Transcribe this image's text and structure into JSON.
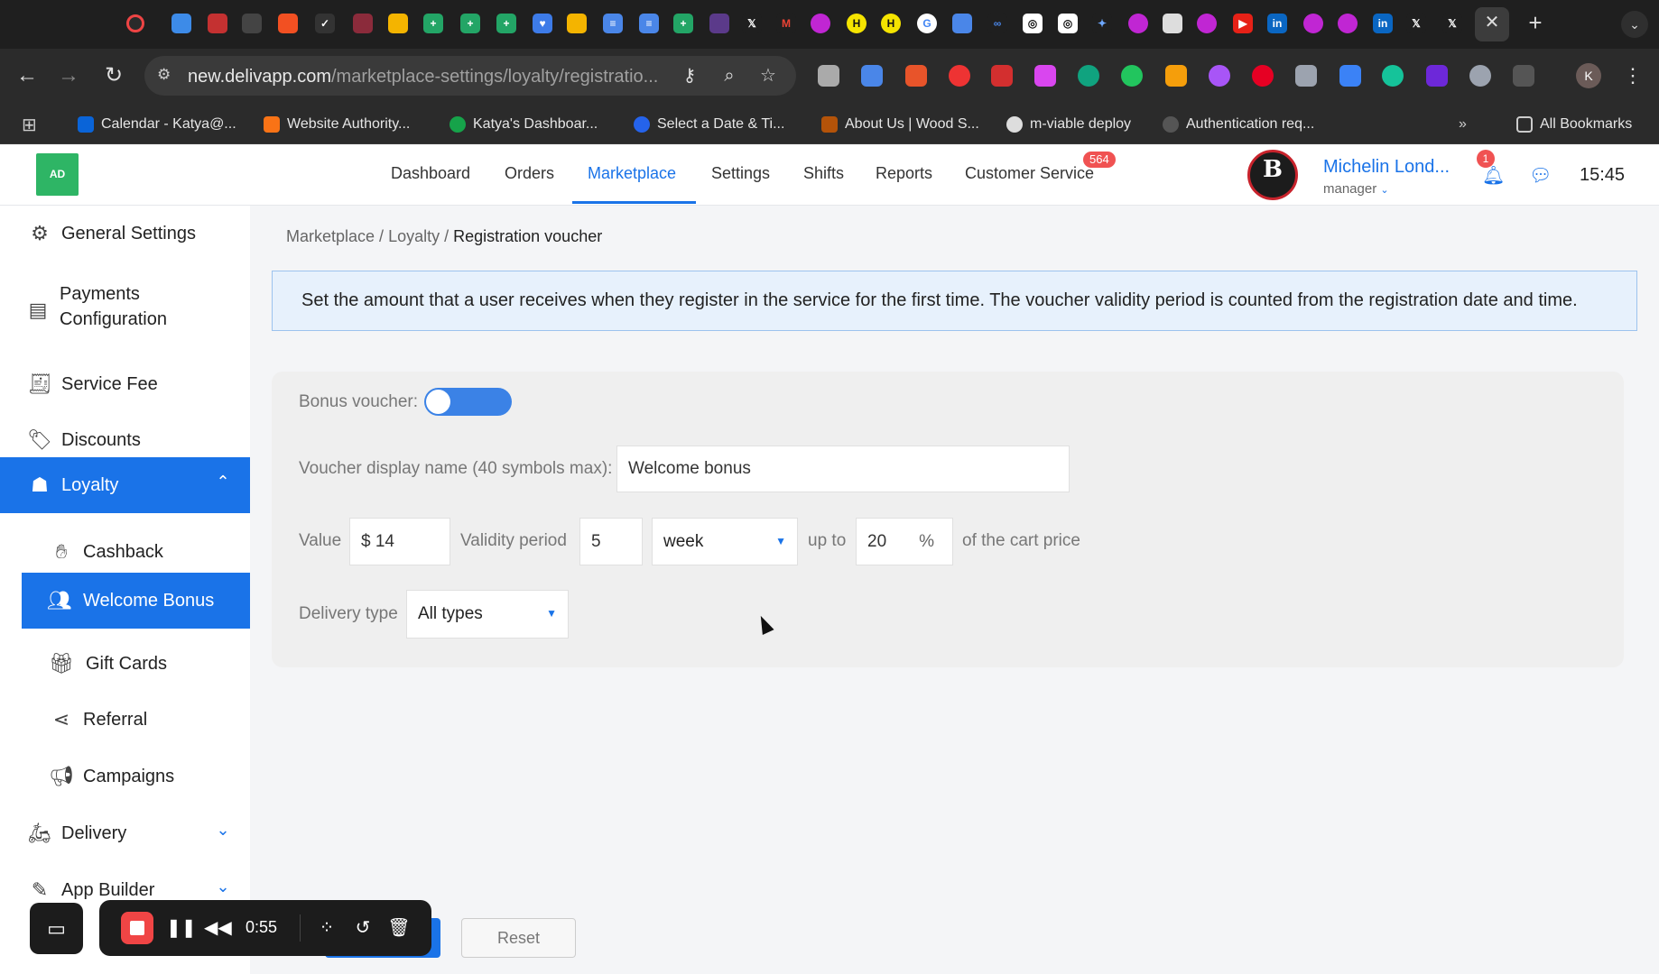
{
  "browser": {
    "url_host": "new.delivapp.com",
    "url_path": "/marketplace-settings/loyalty/registratio...",
    "bookmarks": [
      "Calendar - Katya@...",
      "Website Authority...",
      "Katya's Dashboar...",
      "Select a Date & Ti...",
      "About Us | Wood S...",
      "m-viable deploy",
      "Authentication req...",
      "All Bookmarks"
    ],
    "profile_initial": "K"
  },
  "header": {
    "logo": "AD",
    "nav": [
      "Dashboard",
      "Orders",
      "Marketplace",
      "Settings",
      "Shifts",
      "Reports",
      "Customer Service"
    ],
    "active_nav": "Marketplace",
    "customer_service_badge": "564",
    "user_name": "Michelin Lond...",
    "user_role": "manager",
    "notification_count": "1",
    "time": "15:45",
    "accent_color": "#1a73e8"
  },
  "sidebar": {
    "items": [
      {
        "label": "General Settings",
        "icon": "gear-icon"
      },
      {
        "label": "Payments\nConfiguration",
        "icon": "wallet-icon"
      },
      {
        "label": "Service Fee",
        "icon": "receipt-icon"
      },
      {
        "label": "Discounts",
        "icon": "tag-icon"
      },
      {
        "label": "Loyalty",
        "icon": "loyalty-icon"
      },
      {
        "label": "Cashback",
        "icon": "cashback-icon"
      },
      {
        "label": "Welcome Bonus",
        "icon": "welcome-bonus-icon"
      },
      {
        "label": "Gift Cards",
        "icon": "gift-card-icon"
      },
      {
        "label": "Referral",
        "icon": "share-icon"
      },
      {
        "label": "Campaigns",
        "icon": "megaphone-icon"
      },
      {
        "label": "Delivery",
        "icon": "scooter-icon"
      },
      {
        "label": "App Builder",
        "icon": "magic-wand-icon"
      }
    ]
  },
  "breadcrumb": {
    "parts": [
      "Marketplace",
      "Loyalty"
    ],
    "current": "Registration voucher"
  },
  "info_text": "Set the amount that a user receives when they register in the service for the first time. The voucher validity period is counted from the registration date and time.",
  "form": {
    "bonus_voucher_label": "Bonus voucher:",
    "bonus_voucher_enabled": true,
    "display_name_label": "Voucher display name (40 symbols max):",
    "display_name_value": "Welcome bonus",
    "value_label": "Value",
    "value_value": "$ 14",
    "validity_label": "Validity period",
    "validity_value": "5",
    "validity_unit": "week",
    "up_to_label": "up to",
    "up_to_value": "20",
    "percent_sign": "%",
    "cart_label": "of the cart price",
    "delivery_type_label": "Delivery type",
    "delivery_type_value": "All types"
  },
  "buttons": {
    "reset": "Reset"
  },
  "recorder": {
    "time": "0:55"
  }
}
